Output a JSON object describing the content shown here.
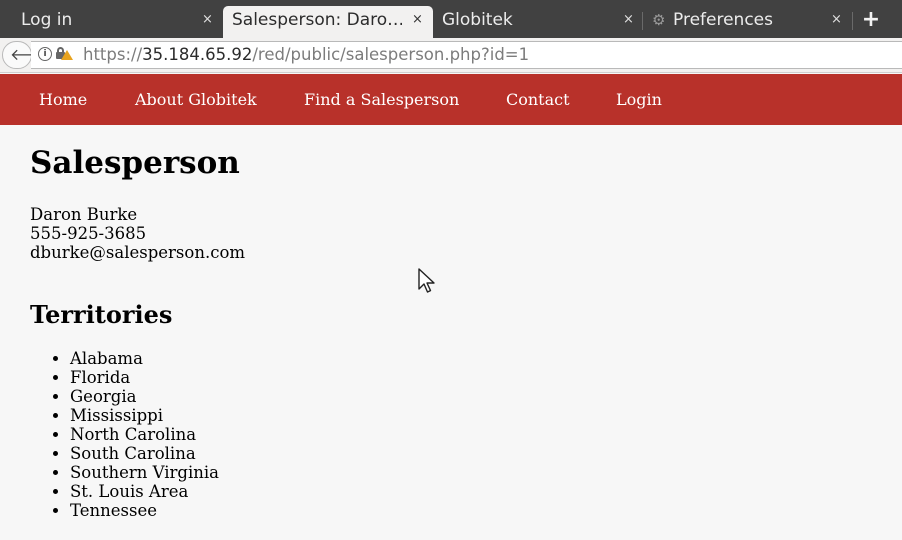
{
  "browser": {
    "tabs": [
      {
        "title": "Log in",
        "close": "×"
      },
      {
        "title": "Salesperson: Daron Burke",
        "display_title": "Salesperson: Daro…",
        "close": "×"
      },
      {
        "title": "Globitek",
        "close": "×"
      },
      {
        "title": "Preferences",
        "close": "×"
      }
    ],
    "new_tab": "+",
    "url_host": "35.184.65.92",
    "url_prefix": "https://",
    "url_path": "/red/public/salesperson.php?id=1"
  },
  "site_nav": {
    "items": [
      "Home",
      "About Globitek",
      "Find a Salesperson",
      "Contact",
      "Login"
    ],
    "color": "#b8312a"
  },
  "page": {
    "title": "Salesperson",
    "name": "Daron Burke",
    "phone": "555-925-3685",
    "email": "dburke@salesperson.com",
    "territories_heading": "Territories",
    "territories": [
      "Alabama",
      "Florida",
      "Georgia",
      "Mississippi",
      "North Carolina",
      "South Carolina",
      "Southern Virginia",
      "St. Louis Area",
      "Tennessee"
    ]
  }
}
